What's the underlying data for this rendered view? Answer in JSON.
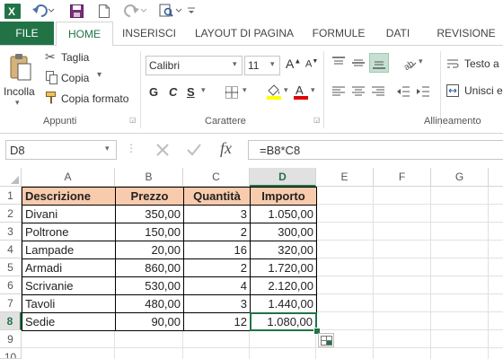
{
  "window": {
    "colors": {
      "accent": "#217346",
      "header_fill": "#f8cbad",
      "selection": "#217346"
    }
  },
  "qat": {
    "icons": [
      "excel-logo-icon",
      "undo-icon",
      "save-icon",
      "new-document-icon",
      "redo-icon",
      "print-preview-icon",
      "customize-icon"
    ]
  },
  "tabs": [
    {
      "label": "FILE"
    },
    {
      "label": "HOME"
    },
    {
      "label": "INSERISCI"
    },
    {
      "label": "LAYOUT DI PAGINA"
    },
    {
      "label": "FORMULE"
    },
    {
      "label": "DATI"
    },
    {
      "label": "REVISIONE"
    }
  ],
  "ribbon": {
    "clipboard": {
      "paste_label": "Incolla",
      "cut_label": "Taglia",
      "copy_label": "Copia",
      "format_painter_label": "Copia formato",
      "group_label": "Appunti"
    },
    "font": {
      "font_name": "Calibri",
      "font_size": "11",
      "bold_label": "G",
      "italic_label": "C",
      "underline_label": "S",
      "group_label": "Carattere"
    },
    "alignment": {
      "wrap_label": "Testo a",
      "merge_label": "Unisci e",
      "group_label": "Allineamento"
    }
  },
  "formula_bar": {
    "name_box": "D8",
    "fx_label": "fx",
    "formula": "=B8*C8"
  },
  "sheet": {
    "columns": [
      "A",
      "B",
      "C",
      "D",
      "E",
      "F",
      "G"
    ],
    "rows": [
      "1",
      "2",
      "3",
      "4",
      "5",
      "6",
      "7",
      "8",
      "9",
      "10"
    ],
    "headers": [
      "Descrizione",
      "Prezzo",
      "Quantità",
      "Importo"
    ],
    "data": [
      [
        "Divani",
        "350,00",
        "3",
        "1.050,00"
      ],
      [
        "Poltrone",
        "150,00",
        "2",
        "300,00"
      ],
      [
        "Lampade",
        "20,00",
        "16",
        "320,00"
      ],
      [
        "Armadi",
        "860,00",
        "2",
        "1.720,00"
      ],
      [
        "Scrivanie",
        "530,00",
        "4",
        "2.120,00"
      ],
      [
        "Tavoli",
        "480,00",
        "3",
        "1.440,00"
      ],
      [
        "Sedie",
        "90,00",
        "12",
        "1.080,00"
      ]
    ],
    "active_cell": "D8"
  }
}
